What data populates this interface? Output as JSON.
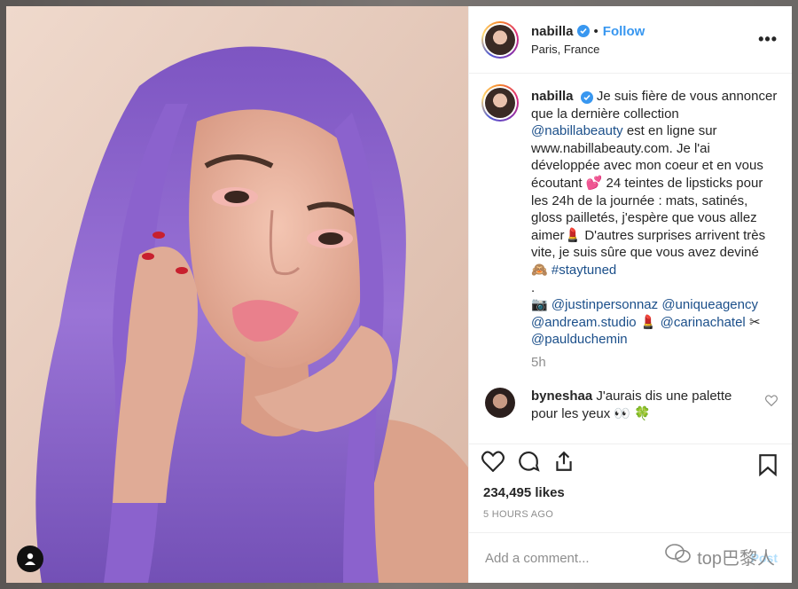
{
  "post": {
    "username": "nabilla",
    "follow_label": "Follow",
    "separator": "•",
    "location": "Paris, France",
    "more_label": "•••"
  },
  "caption": {
    "username": "nabilla",
    "line1": "Je suis fière de vous annoncer que la dernière collection",
    "mention_brand": "@nabillabeauty",
    "line2": "est en ligne sur www.nabillabeauty.com. Je l'ai développée avec mon coeur et en vous écoutant 💕  24 teintes de lipsticks pour les 24h de la journée : mats, satinés, gloss pailletés, j'espère que vous allez aimer💄  D'autres surprises arrivent très vite, je suis sûre que vous avez deviné 🙈 ",
    "hashtag": "#staytuned",
    "dot": ".",
    "camera_emoji": "📷",
    "mention1": "@justinpersonnaz",
    "mention2": "@uniqueagency",
    "mention3": "@andream.studio",
    "lipstick_emoji": "💄",
    "mention4": "@carinachatel",
    "scissors_emoji": "✂",
    "mention5": "@paulduchemin",
    "time": "5h"
  },
  "reply": {
    "username": "byneshaa",
    "text": "J'aurais dis une palette pour les yeux 👀 🍀"
  },
  "stats": {
    "likes": "234,495 likes",
    "ago": "5 HOURS AGO"
  },
  "composer": {
    "placeholder": "Add a comment...",
    "post_label": "Post"
  },
  "watermark": {
    "text": "top巴黎人"
  },
  "colors": {
    "accent": "#3897f0",
    "hair": "#8a63c8",
    "lips": "#e9808c"
  }
}
